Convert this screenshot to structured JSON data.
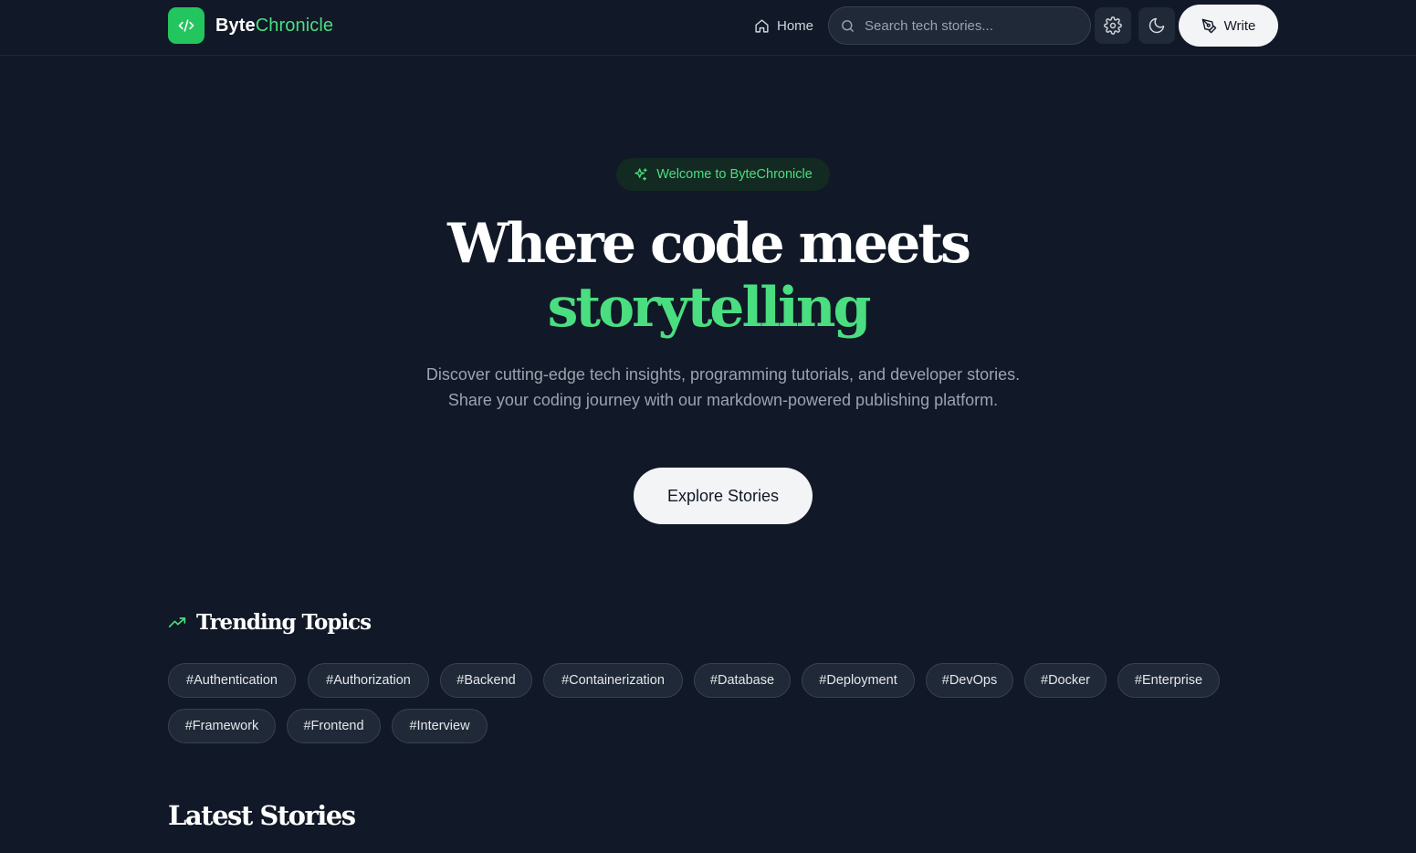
{
  "header": {
    "brand_part1": "Byte",
    "brand_part2": "Chronicle",
    "brand_icon": "code-icon",
    "nav_home": "Home",
    "search_placeholder": "Search tech stories...",
    "write_label": "Write"
  },
  "hero": {
    "welcome": "Welcome to ByteChronicle",
    "title_line1": "Where code meets",
    "title_line2": "storytelling",
    "description": "Discover cutting-edge tech insights, programming tutorials, and developer stories. Share your coding journey with our markdown-powered publishing platform.",
    "cta": "Explore Stories"
  },
  "trending": {
    "title": "Trending Topics",
    "tags": [
      "#Authentication",
      "#Authorization",
      "#Backend",
      "#Containerization",
      "#Database",
      "#Deployment",
      "#DevOps",
      "#Docker",
      "#Enterprise",
      "#Framework",
      "#Frontend",
      "#Interview"
    ]
  },
  "latest": {
    "title": "Latest Stories"
  },
  "colors": {
    "background": "#111827",
    "accent": "#4ade80",
    "brand_green": "#22c55e",
    "surface": "#1f2937"
  }
}
